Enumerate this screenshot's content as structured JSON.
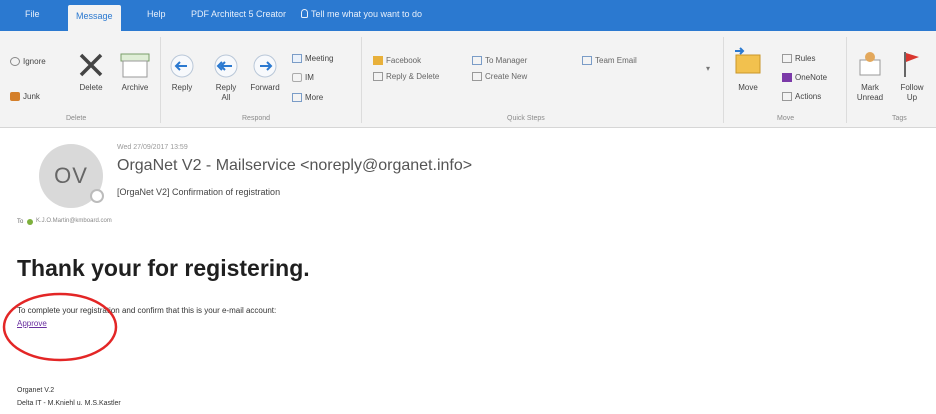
{
  "tabs": {
    "file": "File",
    "message": "Message",
    "help": "Help",
    "pdf": "PDF Architect 5 Creator",
    "tell": "Tell me what you want to do"
  },
  "ribbon": {
    "delete_group": {
      "ignore": "Ignore",
      "junk": "Junk",
      "delete": "Delete",
      "archive": "Archive",
      "label": "Delete"
    },
    "respond_group": {
      "reply": "Reply",
      "reply_all_1": "Reply",
      "reply_all_2": "All",
      "forward": "Forward",
      "meeting": "Meeting",
      "im": "IM",
      "more": "More",
      "label": "Respond"
    },
    "quick_steps": {
      "facebook": "Facebook",
      "reply_delete": "Reply & Delete",
      "to_manager": "To Manager",
      "create_new": "Create New",
      "team_email": "Team Email",
      "label": "Quick Steps"
    },
    "move_group": {
      "move": "Move",
      "rules": "Rules",
      "onenote": "OneNote",
      "actions": "Actions",
      "label": "Move"
    },
    "tags_group": {
      "mark_1": "Mark",
      "mark_2": "Unread",
      "follow_1": "Follow",
      "follow_2": "Up",
      "label": "Tags"
    }
  },
  "header": {
    "initials": "OV",
    "date": "Wed 27/09/2017 13:59",
    "sender": "OrgaNet V2 - Mailservice <noreply@organet.info>",
    "subject": "[OrgaNet V2] Confirmation of registration",
    "to_label": "To",
    "to_address": "K.J.O.Martin@kmboard.com"
  },
  "body": {
    "heading": "Thank your for registering.",
    "instruction": "To complete your registration and confirm that this is your e-mail account:",
    "link": "Approve",
    "sig_line1": "Organet V.2",
    "sig_line2": "Delta IT - M.Kniehl u. M.S.Kastler"
  },
  "colors": {
    "accent": "#2b79d0",
    "annotation": "#e32626",
    "link": "#6a2fa0"
  }
}
